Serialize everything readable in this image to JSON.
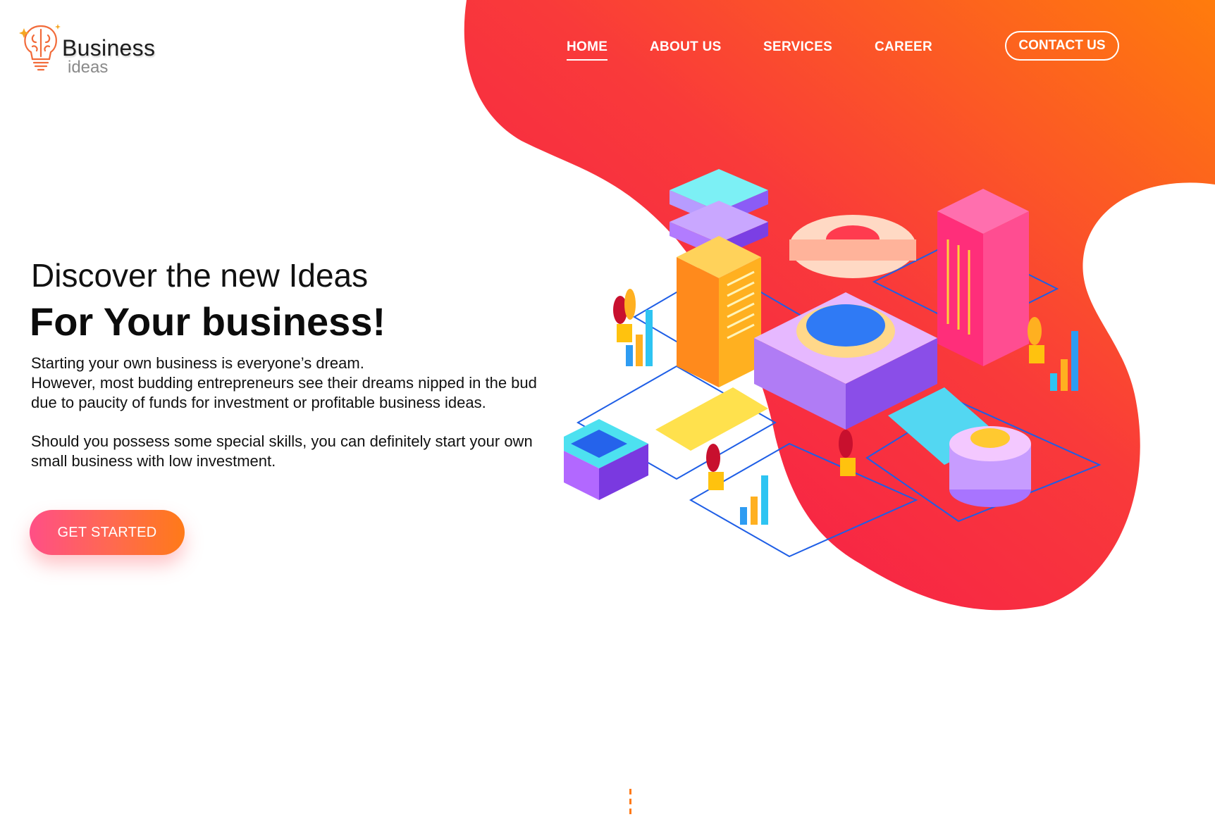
{
  "brand": {
    "name_line1": "Business",
    "name_line2": "ideas",
    "icon": "brain-bulb-icon"
  },
  "nav": {
    "items": [
      {
        "label": "HOME",
        "active": true
      },
      {
        "label": "ABOUT US",
        "active": false
      },
      {
        "label": "SERVICES",
        "active": false
      },
      {
        "label": "CAREER",
        "active": false
      }
    ],
    "contact_label": "CONTACT US"
  },
  "hero": {
    "title_line1": "Discover the new Ideas",
    "title_line2": "For Your business!",
    "body": [
      "Starting your own business is everyone’s dream.",
      "However, most budding entrepreneurs see their dreams nipped in the bud due to paucity of funds for investment or profitable business ideas."
    ],
    "body2": "Should you possess some special skills, you can definitely start your own small business with low investment.",
    "cta_label": "GET STARTED"
  },
  "illustration": {
    "icon": "isometric-business-machinery-illustration"
  },
  "colors": {
    "gradient_start": "#f51b5a",
    "gradient_end": "#ff7a0f",
    "cta_start": "#ff4f86",
    "cta_end": "#ff7a18"
  }
}
